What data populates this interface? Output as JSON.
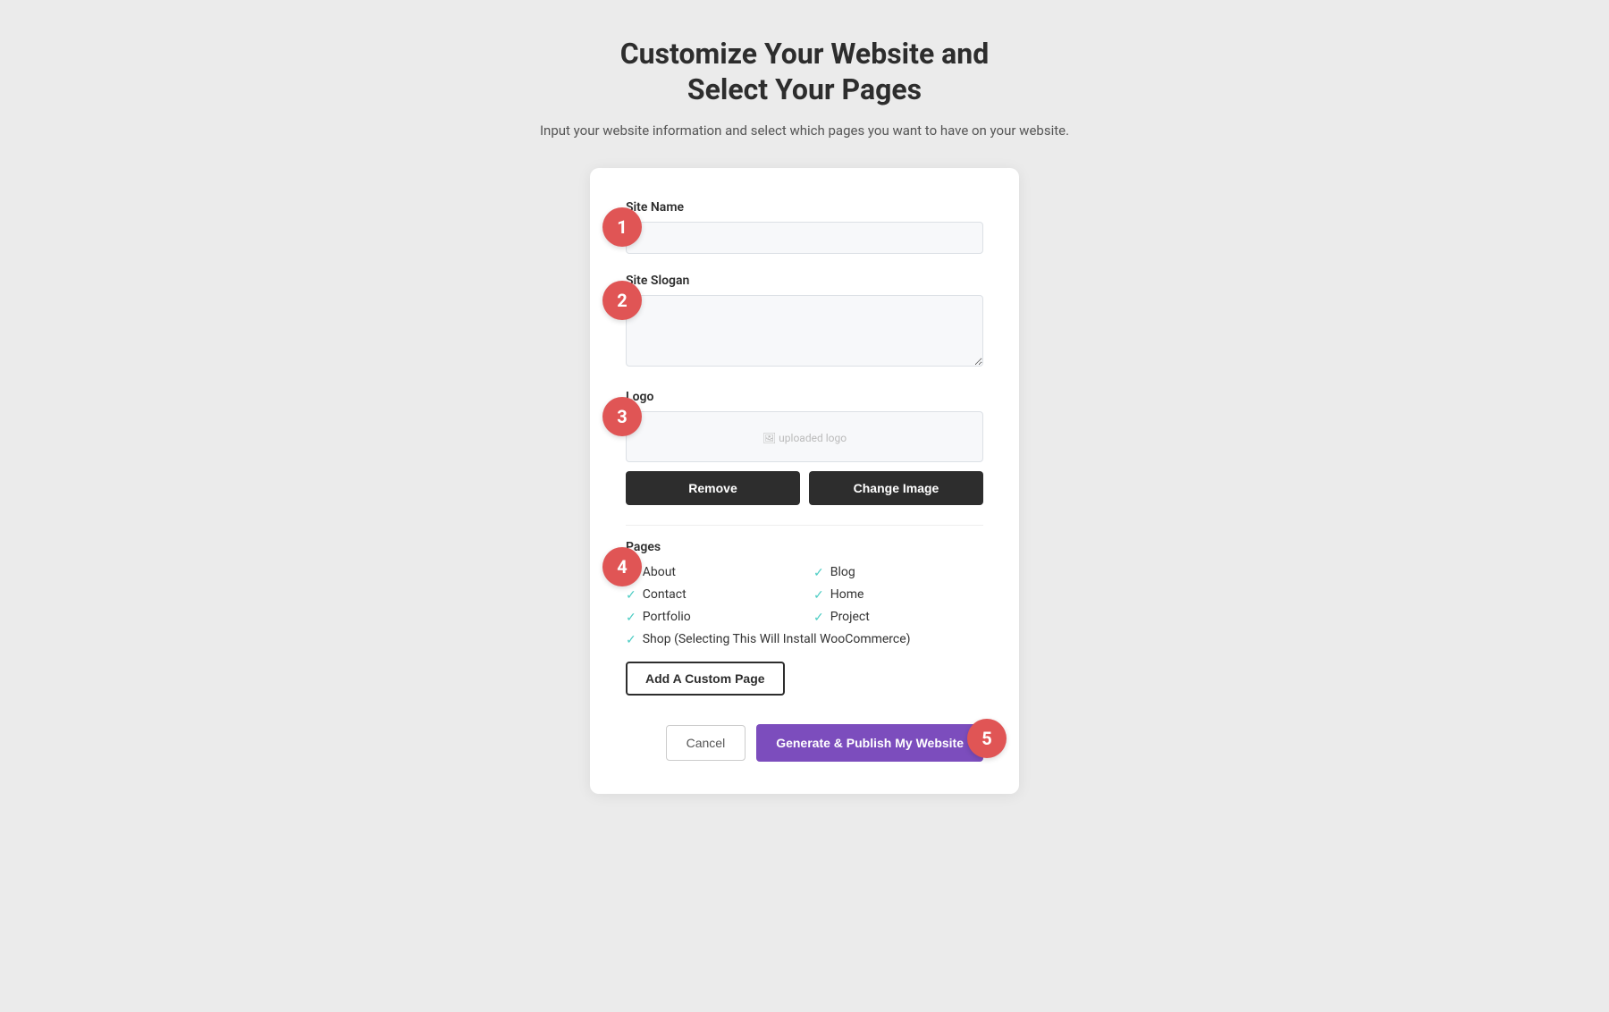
{
  "header": {
    "title_line1": "Customize Your Website and",
    "title_line2": "Select Your Pages",
    "subtitle": "Input your website information and select which pages you want to have on your website."
  },
  "form": {
    "site_name_label": "Site Name",
    "site_name_placeholder": "",
    "site_name_value": "",
    "site_slogan_label": "Site Slogan",
    "site_slogan_placeholder": "",
    "site_slogan_value": "",
    "logo_label": "Logo",
    "logo_preview_text": "uploaded logo",
    "remove_button": "Remove",
    "change_image_button": "Change Image",
    "pages_label": "Pages",
    "pages": [
      {
        "label": "About",
        "checked": true,
        "col": 1
      },
      {
        "label": "Blog",
        "checked": true,
        "col": 2
      },
      {
        "label": "Contact",
        "checked": true,
        "col": 1
      },
      {
        "label": "Home",
        "checked": true,
        "col": 2
      },
      {
        "label": "Portfolio",
        "checked": true,
        "col": 1
      },
      {
        "label": "Project",
        "checked": true,
        "col": 2
      },
      {
        "label": "Shop (Selecting This Will Install WooCommerce)",
        "checked": true,
        "col": 1,
        "full": true
      }
    ],
    "add_custom_page_button": "Add A Custom Page",
    "cancel_button": "Cancel",
    "publish_button": "Generate & Publish My Website"
  },
  "steps": {
    "step1": "1",
    "step2": "2",
    "step3": "3",
    "step4": "4",
    "step5": "5"
  },
  "colors": {
    "bubble_bg": "#e05555",
    "checkmark": "#4ecdc4",
    "publish_bg": "#7c4dbd"
  }
}
